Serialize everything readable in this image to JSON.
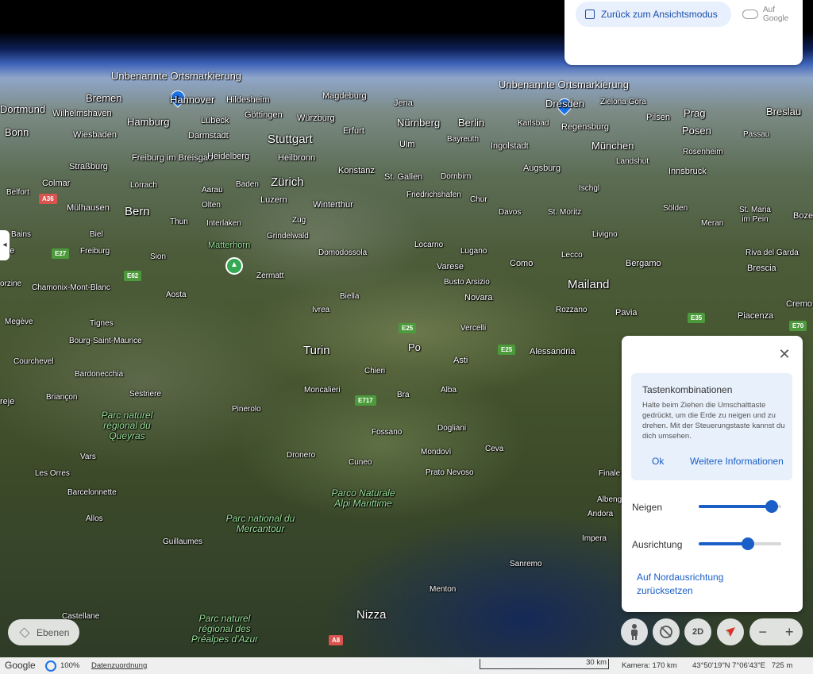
{
  "header": {
    "back_label": "Zurück zum Ansichtsmodus",
    "save_label": "Auf Google"
  },
  "map": {
    "placemark_label_1": "Unbenannte Ortsmarkierung",
    "placemark_label_2": "Unbenannte Ortsmarkierung",
    "places": {
      "dortmund": "Dortmund",
      "wilhelmshaven": "Wilhelmshaven",
      "bremen": "Bremen",
      "hannover": "Hannover",
      "hildesheim": "Hildesheim",
      "magdeburg": "Magdeburg",
      "jena": "Jena",
      "dresden": "Dresden",
      "zielona": "Zielona Góra",
      "breslau": "Breslau",
      "bonn": "Bonn",
      "wiesbaden": "Wiesbaden",
      "hamburg": "Hamburg",
      "luebeck": "Lübeck",
      "goettingen": "Göttingen",
      "wuerzburg": "Würzburg",
      "nuernberg": "Nürnberg",
      "berlin": "Berlin",
      "karlsbad": "Karlsbad",
      "regensburg": "Regensburg",
      "pilsen": "Pilsen",
      "prag": "Prag",
      "darmstadt": "Darmstadt",
      "erfurt": "Erfurt",
      "stuttgart": "Stuttgart",
      "bayreuth": "Bayreuth",
      "posen": "Posen",
      "passau": "Passau",
      "freiburg": "Freiburg im Breisgau",
      "heidelberg": "Heidelberg",
      "heilbronn": "Heilbronn",
      "ulm": "Ulm",
      "ingolstadt": "Ingolstadt",
      "muenchen": "München",
      "rosenheim": "Rosenheim",
      "strassburg": "Straßburg",
      "konstanz": "Konstanz",
      "augsburg": "Augsburg",
      "landshut": "Landshut",
      "colmar": "Colmar",
      "loerrach": "Lörrach",
      "zuerich": "Zürich",
      "stgallen": "St. Gallen",
      "dornbirn": "Dornbirn",
      "innsbruck": "Innsbruck",
      "belfort": "Belfort",
      "aarau": "Aarau",
      "baden": "Baden",
      "friedrichshafen": "Friedrichshafen",
      "ischgl": "Ischgl",
      "muelhausen": "Mülhausen",
      "bern": "Bern",
      "olten": "Olten",
      "luzern": "Luzern",
      "winterthur": "Winterthur",
      "chur": "Chur",
      "davos": "Davos",
      "stmoritz": "St. Moritz",
      "soelden": "Sölden",
      "stmaria": "St. Maria im Pein",
      "thun": "Thun",
      "interlaken": "Interlaken",
      "zug": "Zug",
      "bains": "Bains",
      "biel": "Biel",
      "grindelwald": "Grindelwald",
      "livigno": "Livigno",
      "meran": "Meran",
      "bozen": "Boze",
      "freiburg2": "Freiburg",
      "sion": "Sion",
      "matterhorn": "Matterhorn",
      "domodossola": "Domodossola",
      "locarno": "Locarno",
      "lugano": "Lugano",
      "lecco": "Lecco",
      "rivadelgarda": "Riva del Garda",
      "chamonix": "Chamonix-Mont-Blanc",
      "zermatt": "Zermatt",
      "varese": "Varese",
      "como": "Como",
      "bergamo": "Bergamo",
      "brescia": "Brescia",
      "aosta": "Aosta",
      "bustoarsizio": "Busto Arsizio",
      "mailand": "Mailand",
      "megeve": "Megève",
      "biella": "Biella",
      "novara": "Novara",
      "ivrea": "Ivrea",
      "rozzano": "Rozzano",
      "pavia": "Pavia",
      "piacenza": "Piacenza",
      "cremona": "Cremo",
      "tignes": "Tignes",
      "bourgstmaurice": "Bourg-Saint-Maurice",
      "vercelli": "Vercelli",
      "turin": "Turin",
      "po": "Po",
      "alessandria": "Alessandria",
      "courchevel": "Courchevel",
      "bardonecchia": "Bardonecchia",
      "chieri": "Chieri",
      "asti": "Asti",
      "moncalieri": "Moncalieri",
      "bra": "Bra",
      "alba": "Alba",
      "briancon": "Briançon",
      "sestriere": "Sestriere",
      "pinerolo": "Pinerolo",
      "dogliani": "Dogliani",
      "fossano": "Fossano",
      "mondovi": "Mondovì",
      "ceva": "Ceva",
      "dronero": "Dronero",
      "cuneo": "Cuneo",
      "vars": "Vars",
      "lesorres": "Les Orres",
      "pratonevoso": "Prato Nevoso",
      "finale": "Finale",
      "barcelonnette": "Barcelonnette",
      "albenga": "Albeng",
      "allos": "Allos",
      "andora": "Andora",
      "guillaumes": "Guillaumes",
      "imperia": "Impera",
      "sanremo": "Sanremo",
      "menton": "Menton",
      "castellane": "Castellane",
      "nizza": "Nizza",
      "orzine": "orzine",
      "nne": "nne",
      "reje": "reje"
    },
    "parks": {
      "queyras": "Parc naturel régional du Queyras",
      "alpimarittime": "Parco Naturale Alpi Marittime",
      "mercantour": "Parc national du Mercantour",
      "prealpes": "Parc naturel régional des Préalpes d'Azur"
    },
    "roads": {
      "a36": "A36",
      "e27": "E27",
      "e62": "E62",
      "e25a": "E25",
      "e25b": "E25",
      "e35": "E35",
      "e70": "E70",
      "e717": "E717",
      "a8": "A8"
    }
  },
  "panel": {
    "tips_title": "Tastenkombinationen",
    "tips_text": "Halte beim Ziehen die Umschalttaste gedrückt, um die Erde zu neigen und zu drehen. Mit der Steuerungstaste kannst du dich umsehen.",
    "ok_label": "Ok",
    "more_label": "Weitere Informationen",
    "tilt_label": "Neigen",
    "tilt_value": 0.88,
    "heading_label": "Ausrichtung",
    "heading_value": 0.6,
    "north_reset_label": "Auf Nordausrichtung zurücksetzen"
  },
  "controls": {
    "layers_label": "Ebenen",
    "btn_2d_label": "2D",
    "zoom_out": "−",
    "zoom_in": "+"
  },
  "footer": {
    "brand": "Google",
    "percent": "100%",
    "attribution": "Datenzuordnung",
    "scale": "30 km",
    "camera": "Kamera: 170 km",
    "coords": "43°50'19\"N 7°06'43\"E   725 m"
  },
  "colors": {
    "accent": "#1a5ec8",
    "pin": "#1a73e8",
    "park_label": "#9be39b"
  },
  "icons": [
    "image-icon",
    "cloud-icon",
    "chevron-left-icon",
    "close-icon",
    "pegman-icon",
    "rotate-icon",
    "compass-icon",
    "layers-icon",
    "globe-icon",
    "mountain-icon"
  ]
}
